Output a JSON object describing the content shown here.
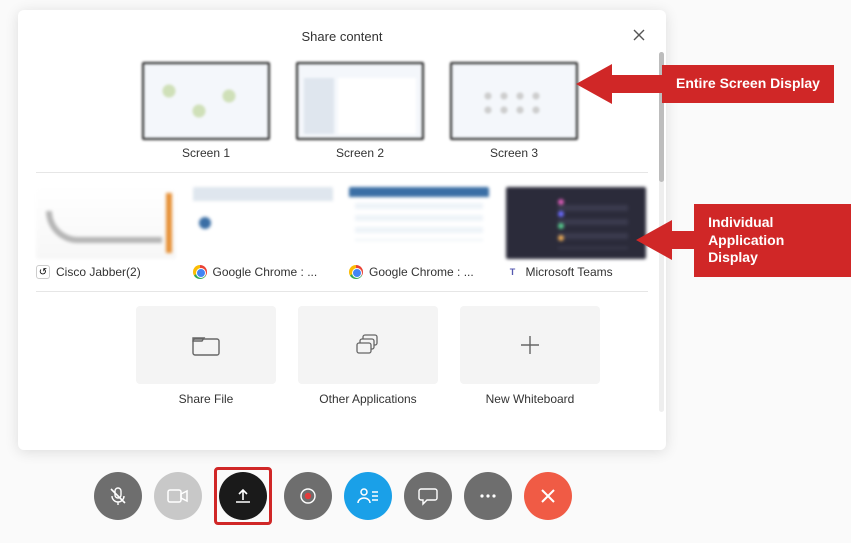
{
  "panel": {
    "title": "Share content"
  },
  "screens": [
    {
      "label": "Screen 1"
    },
    {
      "label": "Screen 2"
    },
    {
      "label": "Screen 3"
    }
  ],
  "apps": [
    {
      "label": "Cisco Jabber(2)",
      "icon": "cisco-jabber"
    },
    {
      "label": "Google Chrome : ...",
      "icon": "google-chrome"
    },
    {
      "label": "Google Chrome : ...",
      "icon": "google-chrome"
    },
    {
      "label": "Microsoft Teams",
      "icon": "microsoft-teams"
    }
  ],
  "actions": [
    {
      "label": "Share File",
      "icon": "folder"
    },
    {
      "label": "Other Applications",
      "icon": "stack"
    },
    {
      "label": "New Whiteboard",
      "icon": "plus"
    }
  ],
  "controls": {
    "mute": "Mute",
    "video": "Stop video",
    "share": "Share content",
    "record": "Record",
    "participants": "Participants",
    "chat": "Chat",
    "more": "More options",
    "end": "End call"
  },
  "annotations": {
    "screens": "Entire Screen Display",
    "apps": "Individual Application Display"
  },
  "colors": {
    "accent_red": "#d02727",
    "blue": "#1aa0e8",
    "end_red": "#f05b45"
  }
}
